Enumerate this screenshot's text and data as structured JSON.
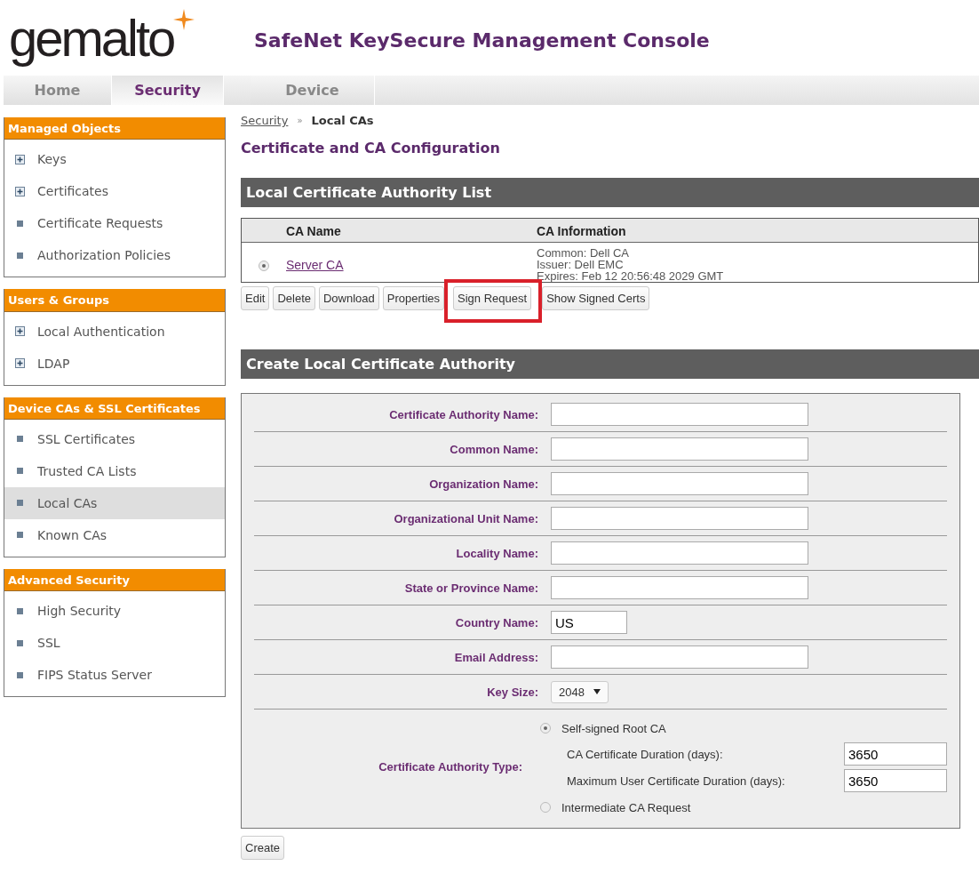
{
  "header": {
    "logo": "gemalto",
    "title": "SafeNet KeySecure Management Console"
  },
  "tabs": [
    {
      "label": "Home",
      "selected": false
    },
    {
      "label": "Security",
      "selected": true
    },
    {
      "label": "Device",
      "selected": false
    }
  ],
  "sidebar": [
    {
      "heading": "Managed Objects",
      "items": [
        {
          "label": "Keys",
          "kind": "expandable",
          "selected": false
        },
        {
          "label": "Certificates",
          "kind": "expandable",
          "selected": false
        },
        {
          "label": "Certificate Requests",
          "kind": "leaf",
          "selected": false
        },
        {
          "label": "Authorization Policies",
          "kind": "leaf",
          "selected": false
        }
      ]
    },
    {
      "heading": "Users & Groups",
      "items": [
        {
          "label": "Local Authentication",
          "kind": "expandable",
          "selected": false
        },
        {
          "label": "LDAP",
          "kind": "expandable",
          "selected": false
        }
      ]
    },
    {
      "heading": "Device CAs & SSL Certificates",
      "items": [
        {
          "label": "SSL Certificates",
          "kind": "leaf",
          "selected": false
        },
        {
          "label": "Trusted CA Lists",
          "kind": "leaf",
          "selected": false
        },
        {
          "label": "Local CAs",
          "kind": "leaf",
          "selected": true
        },
        {
          "label": "Known CAs",
          "kind": "leaf",
          "selected": false
        }
      ]
    },
    {
      "heading": "Advanced Security",
      "items": [
        {
          "label": "High Security",
          "kind": "leaf",
          "selected": false
        },
        {
          "label": "SSL",
          "kind": "leaf",
          "selected": false
        },
        {
          "label": "FIPS Status Server",
          "kind": "leaf",
          "selected": false
        }
      ]
    }
  ],
  "breadcrumb": {
    "link": "Security",
    "separator": "»",
    "current": "Local CAs"
  },
  "page_title": "Certificate and CA Configuration",
  "ca_list": {
    "heading": "Local Certificate Authority List",
    "columns": [
      "CA Name",
      "CA Information"
    ],
    "rows": [
      {
        "selected": true,
        "name": "Server CA",
        "info": [
          "Common: Dell CA",
          "Issuer: Dell EMC",
          "Expires: Feb 12 20:56:48 2029 GMT"
        ]
      }
    ],
    "buttons": [
      {
        "label": "Edit",
        "highlighted": false
      },
      {
        "label": "Delete",
        "highlighted": false
      },
      {
        "label": "Download",
        "highlighted": false
      },
      {
        "label": "Properties",
        "highlighted": false
      },
      {
        "label": "Sign Request",
        "highlighted": true
      },
      {
        "label": "Show Signed Certs",
        "highlighted": false
      }
    ]
  },
  "create_ca": {
    "heading": "Create Local Certificate Authority",
    "fields": [
      {
        "kind": "text",
        "label": "Certificate Authority Name:"
      },
      {
        "kind": "text",
        "label": "Common Name:"
      },
      {
        "kind": "text",
        "label": "Organization Name:"
      },
      {
        "kind": "text",
        "label": "Organizational Unit Name:"
      },
      {
        "kind": "text",
        "label": "Locality Name:"
      },
      {
        "kind": "text",
        "label": "State or Province Name:"
      },
      {
        "kind": "short",
        "label": "Country Name:",
        "value": "US"
      },
      {
        "kind": "text",
        "label": "Email Address:"
      },
      {
        "kind": "select",
        "label": "Key Size:",
        "value": "2048"
      },
      {
        "kind": "ca_type",
        "label": "Certificate Authority Type:",
        "options": [
          {
            "label": "Self-signed Root CA",
            "selected": true,
            "subfields": [
              {
                "label": "CA Certificate Duration (days):",
                "value": "3650"
              },
              {
                "label": "Maximum User Certificate Duration (days):",
                "value": "3650"
              }
            ]
          },
          {
            "label": "Intermediate CA Request",
            "selected": false
          }
        ]
      }
    ],
    "submit": "Create"
  }
}
